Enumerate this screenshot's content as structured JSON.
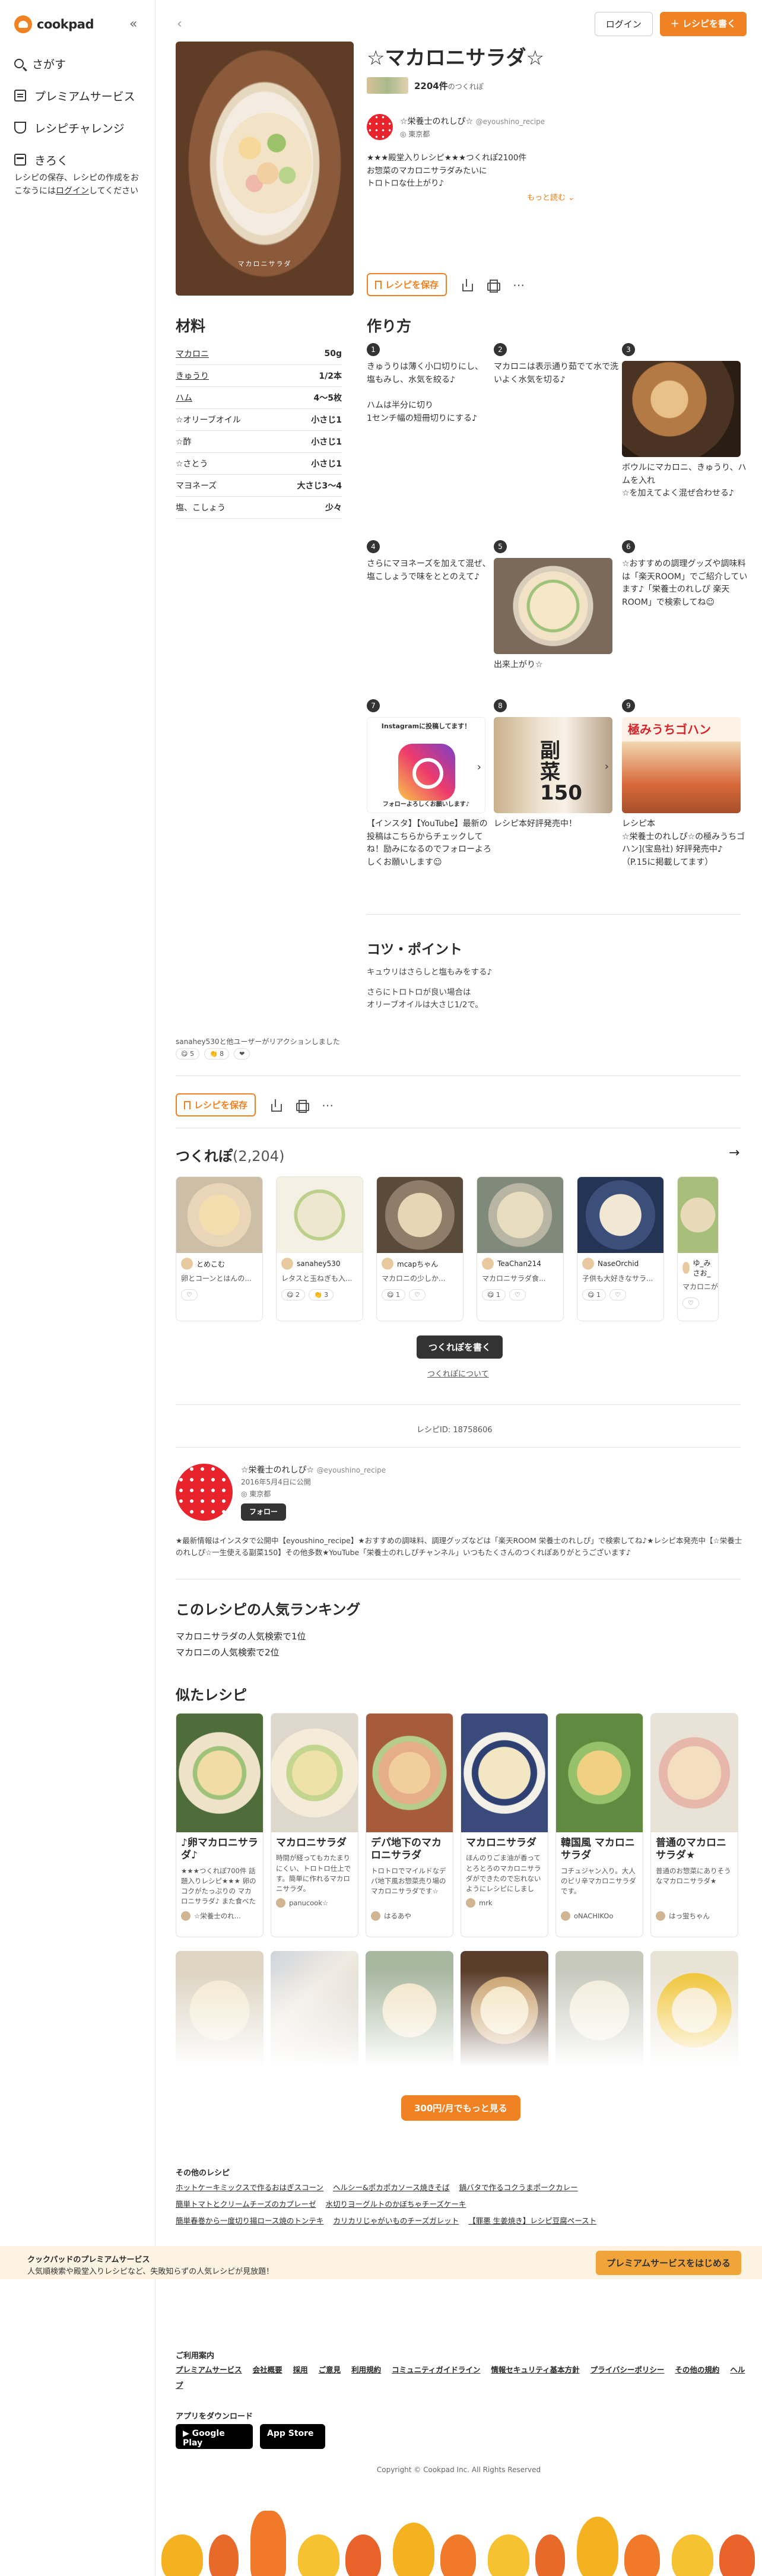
{
  "sidebar": {
    "logo": "cookpad",
    "items": [
      {
        "label": "さがす",
        "icon": "search-icon"
      },
      {
        "label": "プレミアムサービス",
        "icon": "premium-icon"
      },
      {
        "label": "レシピチャレンジ",
        "icon": "trophy-icon"
      },
      {
        "label": "きろく",
        "icon": "folder-icon"
      }
    ],
    "note_before": "レシピの保存、レシピの作成をおこなうには",
    "note_link": "ログイン",
    "note_after": "してください"
  },
  "header": {
    "login": "ログイン",
    "write_recipe": "＋ レシピを書く"
  },
  "recipe": {
    "title": "☆マカロニサラダ☆",
    "tsukurepo_count": "2204件",
    "tsukurepo_suffix": "のつくれぽ",
    "author_name": "☆栄養士のれしぴ☆",
    "author_handle": "@eyoushino_recipe",
    "author_location": "東京都",
    "description": "★★★殿堂入りレシピ★★★つくれぽ2100件\nお惣菜のマカロニサラダみたいに\nトロトロな仕上がり♪",
    "more": "もっと読む ⌄",
    "save": "レシピを保存",
    "hero_caption": "マカロニサラダ"
  },
  "ingredients": {
    "heading": "材料",
    "rows": [
      {
        "name": "マカロニ",
        "qty": "50g"
      },
      {
        "name": "きゅうり",
        "qty": "1/2本"
      },
      {
        "name": "ハム",
        "qty": "4〜5枚"
      },
      {
        "name": "☆オリーブオイル",
        "qty": "小さじ1"
      },
      {
        "name": "☆酢",
        "qty": "小さじ1"
      },
      {
        "name": "☆さとう",
        "qty": "小さじ1"
      },
      {
        "name": "マヨネーズ",
        "qty": "大さじ3〜4"
      },
      {
        "name": "塩、こしょう",
        "qty": "少々"
      }
    ]
  },
  "steps": {
    "heading": "作り方",
    "items": [
      {
        "num": "1",
        "text": "きゅうりは薄く小口切りにし、\n塩もみし、水気を絞る♪\n\nハムは半分に切り\n1センチ幅の短冊切りにする♪"
      },
      {
        "num": "2",
        "text": "マカロニは表示通り茹でて水で洗いよく水気を切る♪"
      },
      {
        "num": "3",
        "text": "ボウルにマカロニ、きゅうり、ハムを入れ\n☆を加えてよく混ぜ合わせる♪"
      },
      {
        "num": "4",
        "text": "さらにマヨネーズを加えて混ぜ、\n塩こしょうで味をととのえて♪"
      },
      {
        "num": "5",
        "text": "出来上がり☆"
      },
      {
        "num": "6",
        "text": "☆おすすめの調理グッズや調味料は「楽天ROOM」でご紹介しています♪「栄養士のれしぴ 楽天ROOM」で検索してね☺"
      },
      {
        "num": "7",
        "text": "【インスタ】【YouTube】最新の投稿はこちらからチェックしてね！励みになるのでフォローよろしくお願いします☺"
      },
      {
        "num": "8",
        "text": "レシピ本好評発売中！"
      },
      {
        "num": "9",
        "text": "レシピ本\n☆栄養士のれしぴ☆の極みうちゴハン](宝島社) 好評発売中♪\n（P.15に掲載してます）"
      }
    ],
    "insta_top": "Instagramに投稿してます！",
    "insta_bottom": "フォローよろしくお願いします♪",
    "book_big": "副菜150",
    "gohan_big": "極みうちゴハン"
  },
  "tips": {
    "heading": "コツ・ポイント",
    "line1": "キュウリはさらしと塩もみをする♪",
    "line2": "さらにトロトロが良い場合は\nオリーブオイルは大さじ1/2で。"
  },
  "reactions": {
    "line": "sanahey530と他ユーザーがリアクションしました",
    "chips": [
      "😋 5",
      "👏 8",
      "❤"
    ]
  },
  "tsukurepo": {
    "heading": "つくれぽ",
    "count": "(2,204)",
    "cards": [
      {
        "user": "とめこむ",
        "text": "卵とコーンとはんの..."
      },
      {
        "user": "sanahey530",
        "text": "レタスと玉ねぎも入..."
      },
      {
        "user": "mcapちゃん",
        "text": "マカロニの少しか..."
      },
      {
        "user": "TeaChan214",
        "text": "マカロニサラダ食..."
      },
      {
        "user": "NaseOrchid",
        "text": "子供も大好きなサラ..."
      },
      {
        "user": "ゆ_みさお_",
        "text": "マカロニが難しいな..."
      }
    ],
    "write": "つくれぽを書く",
    "about": "つくれぽについて"
  },
  "recipe_id": "レシピID: 18758606",
  "author_box": {
    "name": "☆栄養士のれしぴ☆",
    "handle": "@eyoushino_recipe",
    "since": "2016年5月4日に公開",
    "location": "東京都",
    "follow": "フォロー",
    "desc": "★最新情報はインスタで公開中【eyoushino_recipe】★おすすめの調味料、調理グッズなどは「楽天ROOM 栄養士のれしぴ」で検索してね♪★レシピ本発売中【☆栄養士のれしぴ☆一生使える副菜150】その他多数★YouTube「栄養士のれしぴチャンネル」いつもたくさんのつくれぽありがとうございます♪"
  },
  "ranking": {
    "heading": "このレシピの人気ランキング",
    "line1": "マカロニサラダの人気検索で1位",
    "line2": "マカロニの人気検索で2位"
  },
  "similar": {
    "heading": "似たレシピ",
    "cards": [
      {
        "title": "♪卵マカロニサラダ♪",
        "desc": "★★★つくれぽ700件 話題入りレシピ★★★ 卵のコクがたっぷりの マカロニサラダ♪ また食べたくなる定番サラダ",
        "user": "☆栄養士のれ..."
      },
      {
        "title": "マカロニサラダ",
        "desc": "時間が経ってもカたまりにくい、トロトロ仕上です。簡単に作れるマカロニサラダ。",
        "user": "panucook☆"
      },
      {
        "title": "デパ地下のマカロニサラダ",
        "desc": "トロトロでマイルドなデパ地下風お惣菜売り場のマカロニサラダです☆",
        "user": "はるあや"
      },
      {
        "title": "マカロニサラダ",
        "desc": "ほんのりごま油が香ってとろとろのマカロニサラダができたので忘れないようにレシピにしました！",
        "user": "mrk"
      },
      {
        "title": "韓国風 マカロニサラダ",
        "desc": "コチュジャン入り。大人のピリ辛マカロニサラダです。",
        "user": "oNACHIKOo"
      },
      {
        "title": "普通のマカロニサラダ★",
        "desc": "普通のお惣菜にありそうなマカロニサラダ★",
        "user": "はっ蛍ちゃん"
      }
    ],
    "more": "300円/月でもっと見る"
  },
  "other": {
    "heading": "その他のレシピ",
    "links": [
      "ホットケーキミックスで作るおはぎスコーン",
      "ヘルシー&ポカポカソース焼きそば",
      "鍋バタで作るコクうまポークカレー",
      "簡単トマトとクリームチーズのカプレーゼ",
      "水切りヨーグルトのかぼちゃチーズケーキ",
      "簡単春巻から一度切り揚ロース焼のトンテキ",
      "カリカリじゃがいものチーズガレット",
      "【罪悪 生姜焼き】レシピ豆腐ペースト"
    ]
  },
  "banner": {
    "title": "クックパッドのプレミアムサービス",
    "text": "人気順検索や殿堂入りレシピなど、失敗知らずの人気レシピが見放題！",
    "cta": "プレミアムサービスをはじめる"
  },
  "footer": {
    "heading": "ご利用案内",
    "links": [
      "プレミアムサービス",
      "会社概要",
      "採用",
      "ご意見",
      "利用規約",
      "コミュニティガイドライン",
      "情報セキュリティ基本方針",
      "プライバシーポリシー",
      "その他の規約",
      "ヘルプ"
    ],
    "app_heading": "アプリをダウンロード",
    "google_play": "Google Play",
    "app_store": "App Store",
    "copyright": "Copyright © Cookpad Inc. All Rights Reserved"
  },
  "colors": {
    "brand": "#f08224",
    "banner": "#fdf3e2"
  }
}
